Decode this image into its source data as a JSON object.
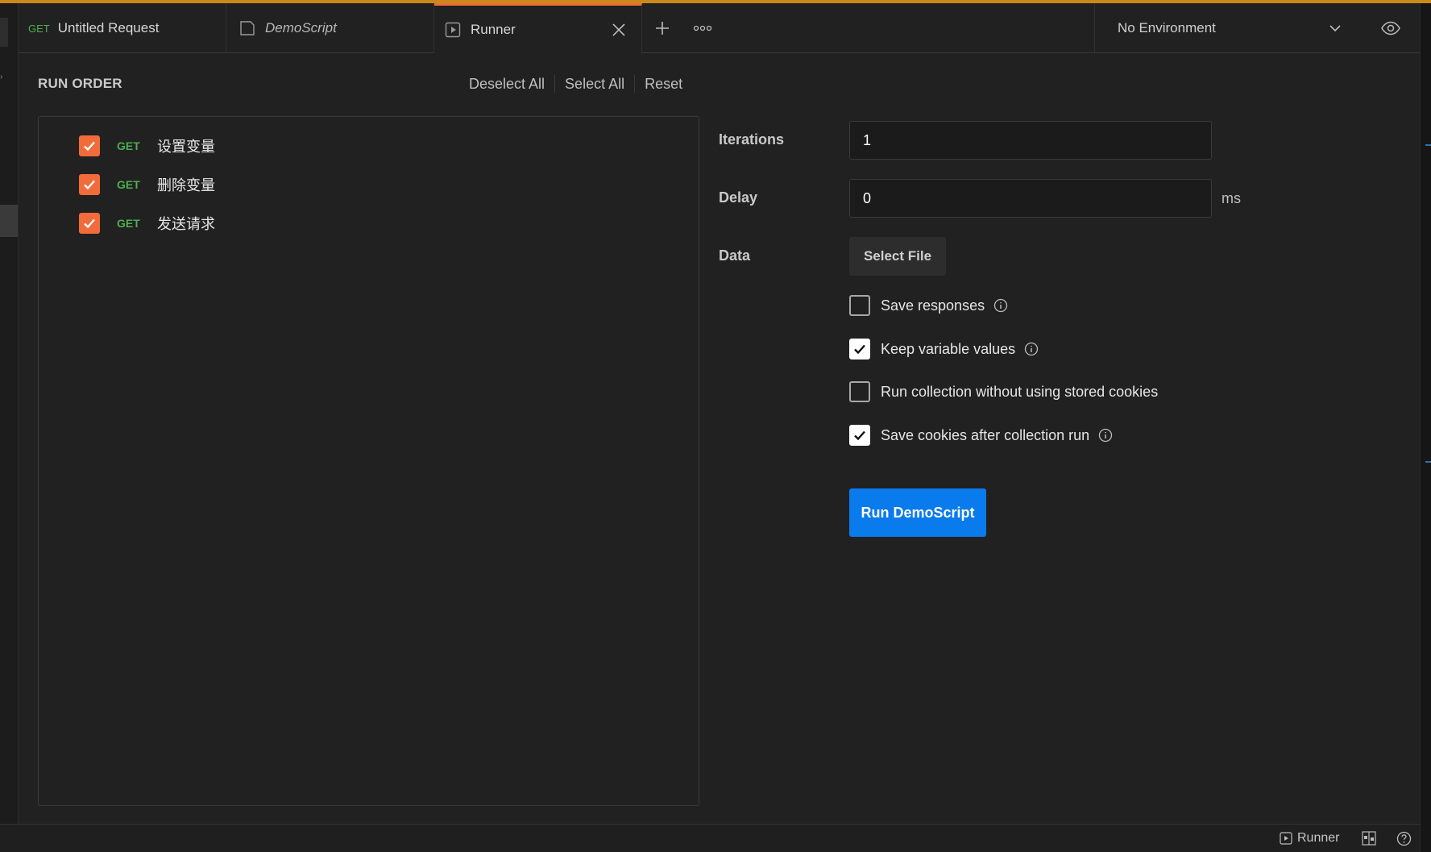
{
  "tabs": [
    {
      "method": "GET",
      "title": "Untitled Request"
    },
    {
      "title": "DemoScript",
      "icon": "collection-icon"
    },
    {
      "title": "Runner",
      "icon": "runner-icon",
      "active": true
    }
  ],
  "environment": {
    "selected": "No Environment"
  },
  "run_order": {
    "title": "RUN ORDER",
    "actions": {
      "deselect_all": "Deselect All",
      "select_all": "Select All",
      "reset": "Reset"
    },
    "items": [
      {
        "method": "GET",
        "name": "设置变量",
        "checked": true
      },
      {
        "method": "GET",
        "name": "删除变量",
        "checked": true
      },
      {
        "method": "GET",
        "name": "发送请求",
        "checked": true
      }
    ]
  },
  "settings": {
    "iterations": {
      "label": "Iterations",
      "value": "1"
    },
    "delay": {
      "label": "Delay",
      "value": "0",
      "unit": "ms"
    },
    "data": {
      "label": "Data",
      "button": "Select File"
    },
    "options": [
      {
        "label": "Save responses",
        "checked": false,
        "info": true
      },
      {
        "label": "Keep variable values",
        "checked": true,
        "info": true
      },
      {
        "label": "Run collection without using stored cookies",
        "checked": false,
        "info": false
      },
      {
        "label": "Save cookies after collection run",
        "checked": true,
        "info": true
      }
    ],
    "run_button": "Run DemoScript"
  },
  "statusbar": {
    "runner_label": "Runner"
  },
  "colors": {
    "accent_orange": "#f26b3a",
    "top_accent": "#c98a1a",
    "primary_blue": "#097bed",
    "method_get": "#4caf50",
    "background": "#212121"
  }
}
